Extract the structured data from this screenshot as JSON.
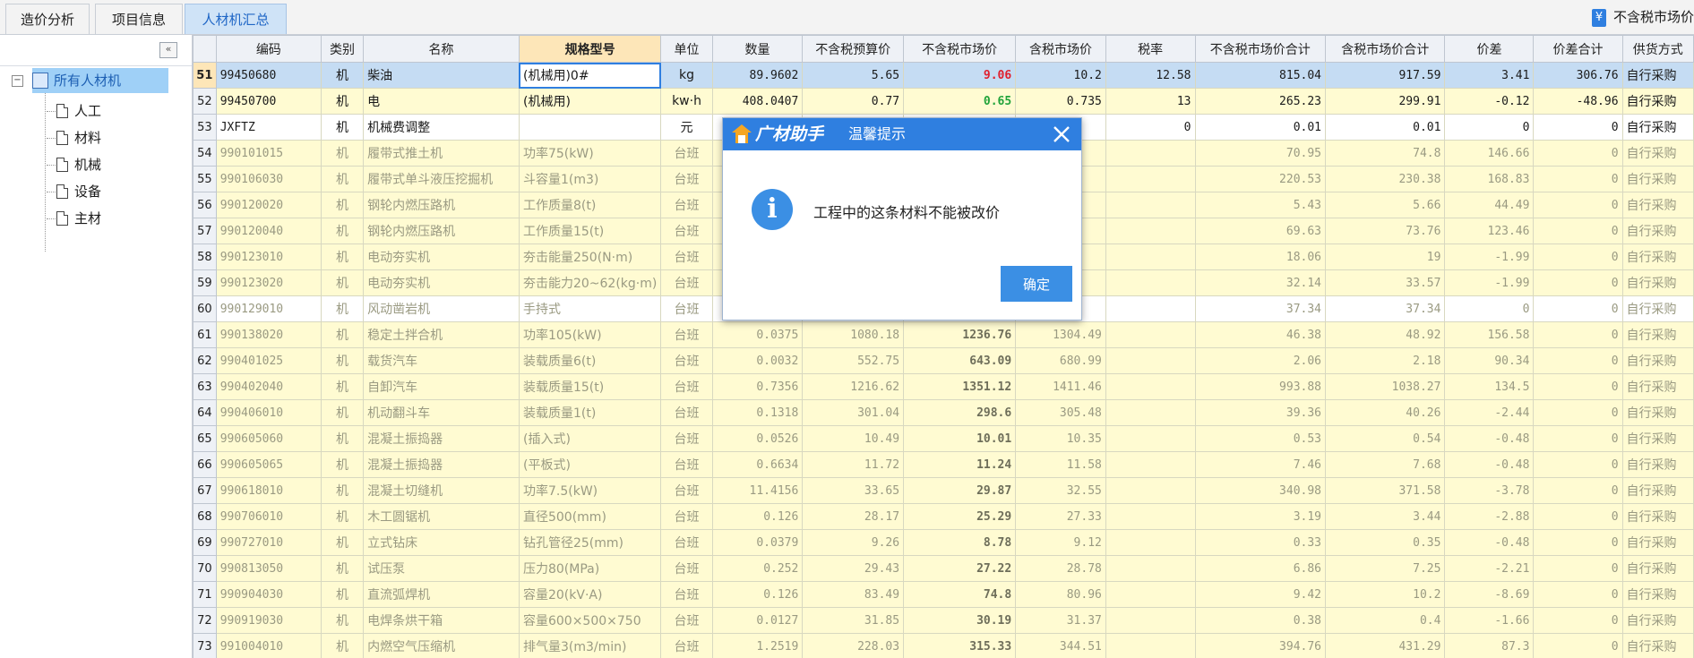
{
  "tabs": [
    {
      "label": "造价分析"
    },
    {
      "label": "项目信息"
    },
    {
      "label": "人材机汇总"
    }
  ],
  "top_right": {
    "label": "不含税市场价"
  },
  "sidebar": {
    "collapse_glyph": "«",
    "root": "所有人材机",
    "items": [
      {
        "label": "人工"
      },
      {
        "label": "材料"
      },
      {
        "label": "机械"
      },
      {
        "label": "设备"
      },
      {
        "label": "主材"
      }
    ]
  },
  "table": {
    "columns": [
      "编码",
      "类别",
      "名称",
      "规格型号",
      "单位",
      "数量",
      "不含税预算价",
      "不含税市场价",
      "含税市场价",
      "税率",
      "不含税市场价合计",
      "含税市场价合计",
      "价差",
      "价差合计",
      "供货方式"
    ],
    "rows": [
      {
        "no": "51",
        "code": "99450680",
        "cat": "机",
        "name": "柴油",
        "spec": "(机械用)0#",
        "unit": "kg",
        "qty": "89.9602",
        "budget": "5.65",
        "market": "9.06",
        "tax_market": "10.2",
        "rate": "12.58",
        "market_total": "815.04",
        "tax_total": "917.59",
        "diff": "3.41",
        "diff_total": "306.76",
        "supply": "自行采购"
      },
      {
        "no": "52",
        "code": "99450700",
        "cat": "机",
        "name": "电",
        "spec": "(机械用)",
        "unit": "kw·h",
        "qty": "408.0407",
        "budget": "0.77",
        "market": "0.65",
        "tax_market": "0.735",
        "rate": "13",
        "market_total": "265.23",
        "tax_total": "299.91",
        "diff": "-0.12",
        "diff_total": "-48.96",
        "supply": "自行采购"
      },
      {
        "no": "53",
        "code": "JXFTZ",
        "cat": "机",
        "name": "机械费调整",
        "spec": "",
        "unit": "元",
        "qty": "",
        "budget": "",
        "market": "",
        "tax_market": "",
        "rate": "0",
        "market_total": "0.01",
        "tax_total": "0.01",
        "diff": "0",
        "diff_total": "0",
        "supply": "自行采购"
      },
      {
        "no": "54",
        "code": "990101015",
        "cat": "机",
        "name": "履带式推土机",
        "spec": "功率75(kW)",
        "unit": "台班",
        "qty": "",
        "budget": "",
        "market": "",
        "tax_market": "",
        "rate": "",
        "market_total": "70.95",
        "tax_total": "74.8",
        "diff": "146.66",
        "diff_total": "0",
        "supply": "自行采购"
      },
      {
        "no": "55",
        "code": "990106030",
        "cat": "机",
        "name": "履带式单斗液压挖掘机",
        "spec": "斗容量1(m3)",
        "unit": "台班",
        "qty": "",
        "budget": "",
        "market": "",
        "tax_market": "",
        "rate": "",
        "market_total": "220.53",
        "tax_total": "230.38",
        "diff": "168.83",
        "diff_total": "0",
        "supply": "自行采购"
      },
      {
        "no": "56",
        "code": "990120020",
        "cat": "机",
        "name": "钢轮内燃压路机",
        "spec": "工作质量8(t)",
        "unit": "台班",
        "qty": "",
        "budget": "",
        "market": "",
        "tax_market": "",
        "rate": "",
        "market_total": "5.43",
        "tax_total": "5.66",
        "diff": "44.49",
        "diff_total": "0",
        "supply": "自行采购"
      },
      {
        "no": "57",
        "code": "990120040",
        "cat": "机",
        "name": "钢轮内燃压路机",
        "spec": "工作质量15(t)",
        "unit": "台班",
        "qty": "",
        "budget": "",
        "market": "",
        "tax_market": "",
        "rate": "",
        "market_total": "69.63",
        "tax_total": "73.76",
        "diff": "123.46",
        "diff_total": "0",
        "supply": "自行采购"
      },
      {
        "no": "58",
        "code": "990123010",
        "cat": "机",
        "name": "电动夯实机",
        "spec": "夯击能量250(N·m)",
        "unit": "台班",
        "qty": "",
        "budget": "",
        "market": "",
        "tax_market": "",
        "rate": "",
        "market_total": "18.06",
        "tax_total": "19",
        "diff": "-1.99",
        "diff_total": "0",
        "supply": "自行采购"
      },
      {
        "no": "59",
        "code": "990123020",
        "cat": "机",
        "name": "电动夯实机",
        "spec": "夯击能力20~62(kg·m)",
        "unit": "台班",
        "qty": "",
        "budget": "",
        "market": "",
        "tax_market": "",
        "rate": "",
        "market_total": "32.14",
        "tax_total": "33.57",
        "diff": "-1.99",
        "diff_total": "0",
        "supply": "自行采购"
      },
      {
        "no": "60",
        "code": "990129010",
        "cat": "机",
        "name": "风动凿岩机",
        "spec": "手持式",
        "unit": "台班",
        "qty": "",
        "budget": "",
        "market": "",
        "tax_market": "",
        "rate": "",
        "market_total": "37.34",
        "tax_total": "37.34",
        "diff": "0",
        "diff_total": "0",
        "supply": "自行采购"
      },
      {
        "no": "61",
        "code": "990138020",
        "cat": "机",
        "name": "稳定土拌合机",
        "spec": "功率105(kW)",
        "unit": "台班",
        "qty": "0.0375",
        "budget": "1080.18",
        "market": "1236.76",
        "tax_market": "1304.49",
        "rate": "",
        "market_total": "46.38",
        "tax_total": "48.92",
        "diff": "156.58",
        "diff_total": "0",
        "supply": "自行采购"
      },
      {
        "no": "62",
        "code": "990401025",
        "cat": "机",
        "name": "载货汽车",
        "spec": "装载质量6(t)",
        "unit": "台班",
        "qty": "0.0032",
        "budget": "552.75",
        "market": "643.09",
        "tax_market": "680.99",
        "rate": "",
        "market_total": "2.06",
        "tax_total": "2.18",
        "diff": "90.34",
        "diff_total": "0",
        "supply": "自行采购"
      },
      {
        "no": "63",
        "code": "990402040",
        "cat": "机",
        "name": "自卸汽车",
        "spec": "装载质量15(t)",
        "unit": "台班",
        "qty": "0.7356",
        "budget": "1216.62",
        "market": "1351.12",
        "tax_market": "1411.46",
        "rate": "",
        "market_total": "993.88",
        "tax_total": "1038.27",
        "diff": "134.5",
        "diff_total": "0",
        "supply": "自行采购"
      },
      {
        "no": "64",
        "code": "990406010",
        "cat": "机",
        "name": "机动翻斗车",
        "spec": "装载质量1(t)",
        "unit": "台班",
        "qty": "0.1318",
        "budget": "301.04",
        "market": "298.6",
        "tax_market": "305.48",
        "rate": "",
        "market_total": "39.36",
        "tax_total": "40.26",
        "diff": "-2.44",
        "diff_total": "0",
        "supply": "自行采购"
      },
      {
        "no": "65",
        "code": "990605060",
        "cat": "机",
        "name": "混凝土振捣器",
        "spec": "(插入式)",
        "unit": "台班",
        "qty": "0.0526",
        "budget": "10.49",
        "market": "10.01",
        "tax_market": "10.35",
        "rate": "",
        "market_total": "0.53",
        "tax_total": "0.54",
        "diff": "-0.48",
        "diff_total": "0",
        "supply": "自行采购"
      },
      {
        "no": "66",
        "code": "990605065",
        "cat": "机",
        "name": "混凝土振捣器",
        "spec": "(平板式)",
        "unit": "台班",
        "qty": "0.6634",
        "budget": "11.72",
        "market": "11.24",
        "tax_market": "11.58",
        "rate": "",
        "market_total": "7.46",
        "tax_total": "7.68",
        "diff": "-0.48",
        "diff_total": "0",
        "supply": "自行采购"
      },
      {
        "no": "67",
        "code": "990618010",
        "cat": "机",
        "name": "混凝土切缝机",
        "spec": "功率7.5(kW)",
        "unit": "台班",
        "qty": "11.4156",
        "budget": "33.65",
        "market": "29.87",
        "tax_market": "32.55",
        "rate": "",
        "market_total": "340.98",
        "tax_total": "371.58",
        "diff": "-3.78",
        "diff_total": "0",
        "supply": "自行采购"
      },
      {
        "no": "68",
        "code": "990706010",
        "cat": "机",
        "name": "木工圆锯机",
        "spec": "直径500(mm)",
        "unit": "台班",
        "qty": "0.126",
        "budget": "28.17",
        "market": "25.29",
        "tax_market": "27.33",
        "rate": "",
        "market_total": "3.19",
        "tax_total": "3.44",
        "diff": "-2.88",
        "diff_total": "0",
        "supply": "自行采购"
      },
      {
        "no": "69",
        "code": "990727010",
        "cat": "机",
        "name": "立式钻床",
        "spec": "钻孔管径25(mm)",
        "unit": "台班",
        "qty": "0.0379",
        "budget": "9.26",
        "market": "8.78",
        "tax_market": "9.12",
        "rate": "",
        "market_total": "0.33",
        "tax_total": "0.35",
        "diff": "-0.48",
        "diff_total": "0",
        "supply": "自行采购"
      },
      {
        "no": "70",
        "code": "990813050",
        "cat": "机",
        "name": "试压泵",
        "spec": "压力80(MPa)",
        "unit": "台班",
        "qty": "0.252",
        "budget": "29.43",
        "market": "27.22",
        "tax_market": "28.78",
        "rate": "",
        "market_total": "6.86",
        "tax_total": "7.25",
        "diff": "-2.21",
        "diff_total": "0",
        "supply": "自行采购"
      },
      {
        "no": "71",
        "code": "990904030",
        "cat": "机",
        "name": "直流弧焊机",
        "spec": "容量20(kV·A)",
        "unit": "台班",
        "qty": "0.126",
        "budget": "83.49",
        "market": "74.8",
        "tax_market": "80.96",
        "rate": "",
        "market_total": "9.42",
        "tax_total": "10.2",
        "diff": "-8.69",
        "diff_total": "0",
        "supply": "自行采购"
      },
      {
        "no": "72",
        "code": "990919030",
        "cat": "机",
        "name": "电焊条烘干箱",
        "spec": "容量600×500×750",
        "unit": "台班",
        "qty": "0.0127",
        "budget": "31.85",
        "market": "30.19",
        "tax_market": "31.37",
        "rate": "",
        "market_total": "0.38",
        "tax_total": "0.4",
        "diff": "-1.66",
        "diff_total": "0",
        "supply": "自行采购"
      },
      {
        "no": "73",
        "code": "991004010",
        "cat": "机",
        "name": "内燃空气压缩机",
        "spec": "排气量3(m3/min)",
        "unit": "台班",
        "qty": "1.2519",
        "budget": "228.03",
        "market": "315.33",
        "tax_market": "344.51",
        "rate": "",
        "market_total": "394.76",
        "tax_total": "431.29",
        "diff": "87.3",
        "diff_total": "0",
        "supply": "自行采购"
      }
    ]
  },
  "dialog": {
    "brand": "广材助手",
    "title": "温馨提示",
    "message": "工程中的这条材料不能被改价",
    "ok_label": "确定",
    "info_glyph": "i"
  },
  "colors": {
    "accent": "#2f7fe0",
    "selected_row": "#c5dcf3",
    "yellow_row": "#fffbd2",
    "price_up": "#e0202e",
    "price_down": "#21a33a"
  }
}
